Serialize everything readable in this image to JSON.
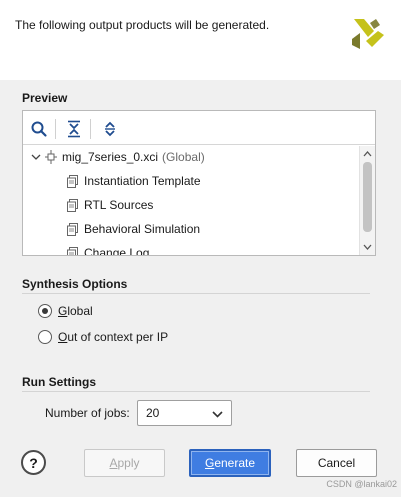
{
  "header": {
    "message": "The following output products will be generated."
  },
  "preview": {
    "title": "Preview",
    "toolbar": {
      "icons": [
        "search-icon",
        "collapse-all-icon",
        "expand-all-icon"
      ]
    },
    "tree": [
      {
        "label": "mig_7series_0.xci",
        "suffix": "(Global)",
        "icon": "ip-chip-icon",
        "expanded": true
      },
      {
        "label": "Instantiation Template",
        "icon": "file-icon"
      },
      {
        "label": "RTL Sources",
        "icon": "file-icon"
      },
      {
        "label": "Behavioral Simulation",
        "icon": "file-icon"
      },
      {
        "label": "Change Log",
        "icon": "file-icon"
      }
    ]
  },
  "synthesis": {
    "title": "Synthesis Options",
    "options": [
      {
        "label_prefix": "",
        "label_mnemonic": "G",
        "label_rest": "lobal",
        "checked": true
      },
      {
        "label_prefix": "",
        "label_mnemonic": "O",
        "label_rest": "ut of context per IP",
        "checked": false
      }
    ]
  },
  "run": {
    "title": "Run Settings",
    "jobs_label_prefix": "Number of ",
    "jobs_label_mnemonic": "j",
    "jobs_label_rest": "obs:",
    "jobs_value": "20"
  },
  "buttons": {
    "help": "?",
    "apply_mnemonic": "A",
    "apply_rest": "pply",
    "generate_mnemonic": "G",
    "generate_rest": "enerate",
    "cancel": "Cancel"
  },
  "watermark": "CSDN @lankai02",
  "colors": {
    "primary_button": "#3f7de2",
    "logo_yellow": "#c5c21b",
    "logo_dark": "#6e6e23"
  }
}
